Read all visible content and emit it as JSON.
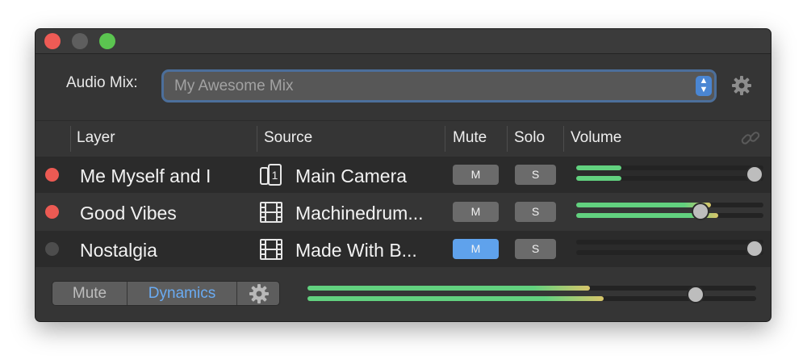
{
  "window": {
    "controls": [
      "close",
      "minimize",
      "zoom"
    ]
  },
  "audio_mix": {
    "label": "Audio Mix:",
    "selected": "My Awesome Mix",
    "settings_icon": "gear-icon"
  },
  "table": {
    "columns": [
      "Layer",
      "Source",
      "Mute",
      "Solo",
      "Volume"
    ],
    "link_icon": "link-icon",
    "rows": [
      {
        "status_color": "#ec5a53",
        "layer": "Me Myself and I",
        "source_icon": "phone-camera-icon",
        "source": "Main Camera",
        "mute_label": "M",
        "mute_on": false,
        "solo_label": "S",
        "volume_levels": [
          0.24,
          0.24
        ],
        "volume_knob": 1.0
      },
      {
        "status_color": "#ec5a53",
        "layer": "Good Vibes",
        "source_icon": "film-icon",
        "source": "Machinedrum...",
        "mute_label": "M",
        "mute_on": false,
        "solo_label": "S",
        "volume_levels": [
          0.72,
          0.76
        ],
        "volume_knob": 0.68
      },
      {
        "status_color": "#4d4d4d",
        "layer": "Nostalgia",
        "source_icon": "film-icon",
        "source": "Made With B...",
        "mute_label": "M",
        "mute_on": true,
        "solo_label": "S",
        "volume_levels": [
          0,
          0
        ],
        "volume_knob": 1.0
      }
    ]
  },
  "footer": {
    "segments": [
      "Mute",
      "Dynamics"
    ],
    "selected_segment": "Dynamics",
    "settings_icon": "gear-icon",
    "master_levels": [
      0.63,
      0.66
    ],
    "master_knob": 0.88
  },
  "colors": {
    "accent_blue": "#5fa2ec",
    "meter_green": "#62d17f",
    "meter_yellow": "#d8c56a",
    "red_status": "#ec5a53"
  }
}
